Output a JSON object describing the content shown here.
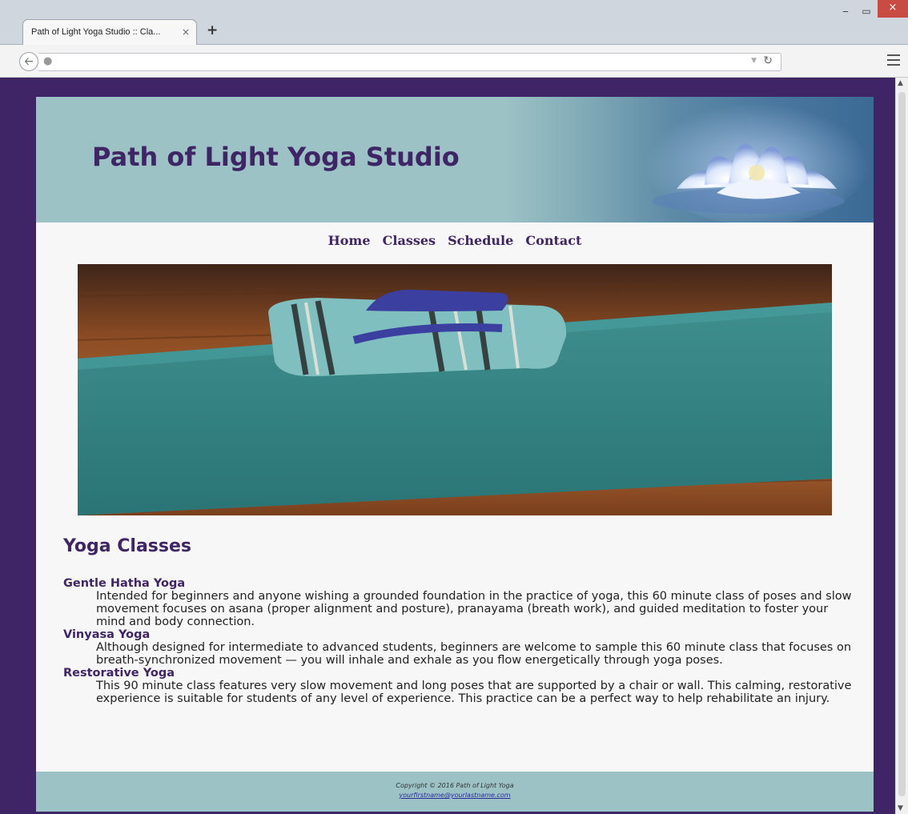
{
  "browser": {
    "tab_title": "Path of Light Yoga Studio :: Cla...",
    "tab_close": "×",
    "new_tab": "+",
    "url": "",
    "window_controls": {
      "minimize": "‒",
      "maximize": "▭",
      "close": "×"
    }
  },
  "site": {
    "title": "Path of Light Yoga Studio",
    "nav": [
      "Home",
      "Classes",
      "Schedule",
      "Contact"
    ],
    "heading": "Yoga Classes",
    "classes": [
      {
        "name": "Gentle Hatha Yoga",
        "description": "Intended for beginners and anyone wishing a grounded foundation in the practice of yoga, this 60 minute class of poses and slow movement focuses on asana (proper alignment and posture), pranayama (breath work), and guided meditation to foster your mind and body connection."
      },
      {
        "name": "Vinyasa Yoga",
        "description": "Although designed for intermediate to advanced students, beginners are welcome to sample this 60 minute class that focuses on breath-synchronized movement — you will inhale and exhale as you flow energetically through yoga poses."
      },
      {
        "name": "Restorative Yoga",
        "description": "This 90 minute class features very slow movement and long poses that are supported by a chair or wall. This calming, restorative experience is suitable for students of any level of experience. This practice can be a perfect way to help rehabilitate an injury."
      }
    ],
    "footer": {
      "copyright": "Copyright © 2016 Path of Light Yoga",
      "email": "yourfirstname@yourlastname.com"
    }
  },
  "colors": {
    "brand_purple": "#3f2565",
    "header_teal": "#9dc2c5",
    "page_bg": "#f8f7f8"
  }
}
